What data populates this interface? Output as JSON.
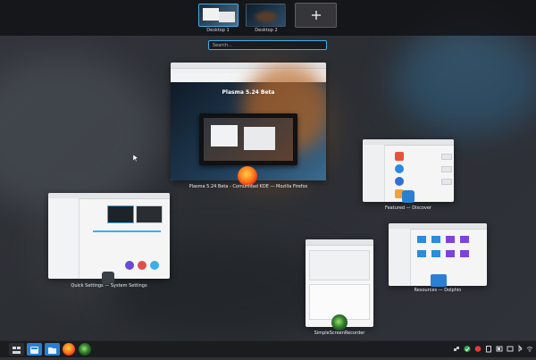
{
  "top_bar": {
    "desktops": [
      {
        "label": "Desktop 1",
        "active": true
      },
      {
        "label": "Desktop 2",
        "active": false
      }
    ],
    "add_desktop_icon": "plus-icon"
  },
  "search": {
    "placeholder": "Search..."
  },
  "windows": {
    "firefox": {
      "caption": "Plasma 5.24 Beta - Comunidad KDE — Mozilla Firefox",
      "page_heading": "Plasma 5.24 Beta",
      "icon": "firefox-icon"
    },
    "discover": {
      "caption": "Featured — Discover",
      "icon": "discover-icon"
    },
    "settings": {
      "caption": "Quick Settings — System Settings",
      "icon": "system-settings-icon"
    },
    "recorder": {
      "caption": "SimpleScreenRecorder",
      "icon": "simplescreenrecorder-icon"
    },
    "dolphin": {
      "caption": "Resources — Dolphin",
      "icon": "dolphin-icon"
    }
  },
  "taskbar": {
    "items": [
      "overview-icon",
      "discover-icon",
      "dolphin-icon",
      "firefox-icon",
      "simplescreenrecorder-icon"
    ],
    "tray": [
      "network-icon",
      "updates-icon",
      "record-icon",
      "clipboard-icon",
      "battery-icon",
      "keyboard-icon",
      "bluetooth-icon",
      "wifi-icon"
    ]
  },
  "colors": {
    "accent": "#3daee9",
    "panel": "#1c1e21"
  }
}
